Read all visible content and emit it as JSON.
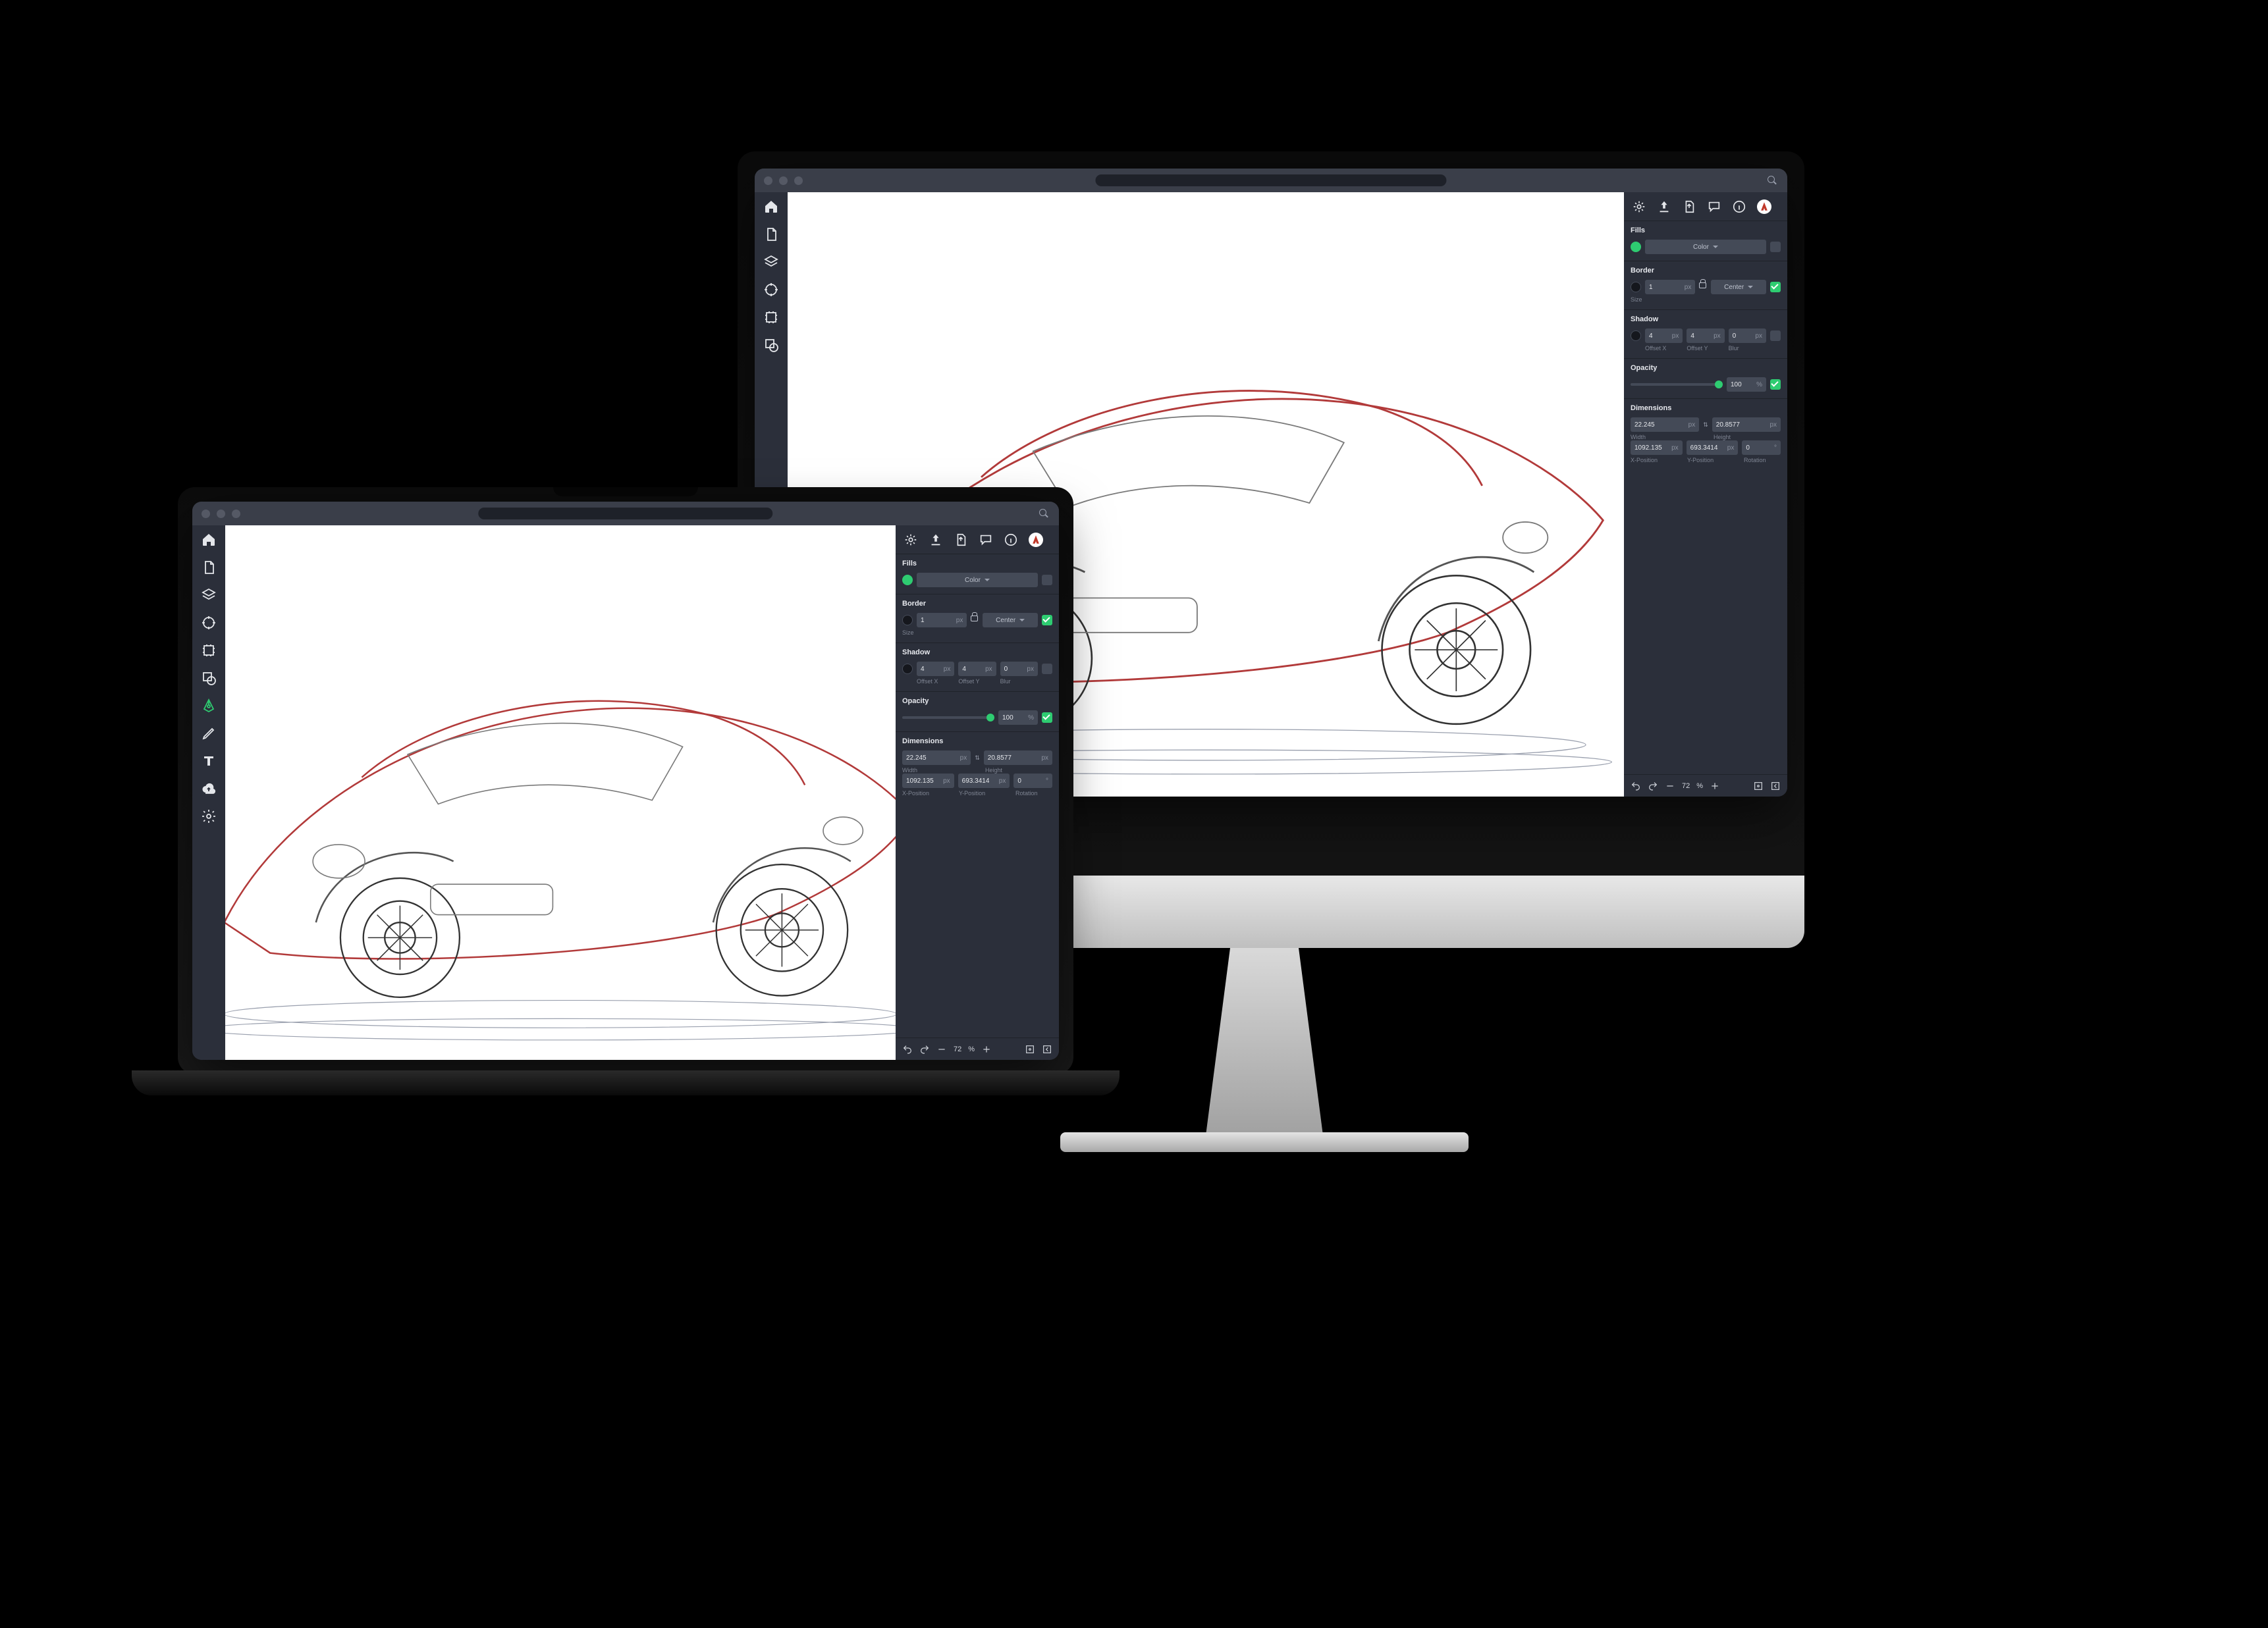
{
  "panel": {
    "fills": {
      "title": "Fills",
      "color_btn": "Color"
    },
    "border": {
      "title": "Border",
      "size": "1",
      "size_unit": "px",
      "size_label": "Size",
      "align": "Center"
    },
    "shadow": {
      "title": "Shadow",
      "ox": "4",
      "oy": "4",
      "blur": "0",
      "unit": "px",
      "ox_label": "Offset X",
      "oy_label": "Offset Y",
      "blur_label": "Blur"
    },
    "opacity": {
      "title": "Opacity",
      "value": "100",
      "unit": "%"
    },
    "dimensions": {
      "title": "Dimensions",
      "w": "22.245",
      "h": "20.8577",
      "x": "1092.135",
      "y": "693.3414",
      "rot": "0",
      "unit": "px",
      "rot_unit": "°",
      "w_label": "Width",
      "h_label": "Height",
      "x_label": "X-Position",
      "y_label": "Y-Position",
      "rot_label": "Rotation"
    }
  },
  "bottombar": {
    "zoom": "72",
    "unit": "%"
  },
  "link_glyph": "⇅"
}
